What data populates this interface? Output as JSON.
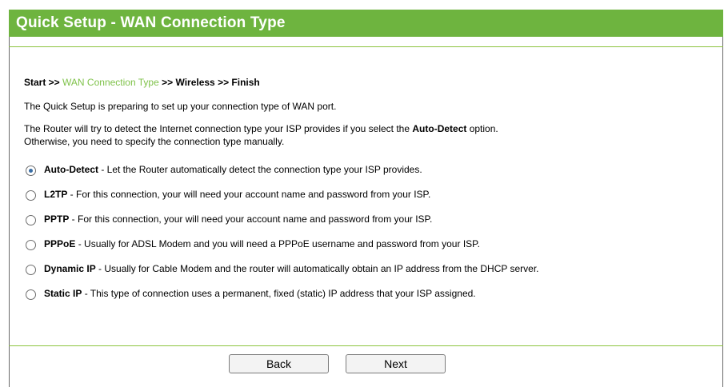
{
  "header": {
    "title": "Quick Setup - WAN Connection Type"
  },
  "breadcrumb": {
    "start": "Start >>",
    "current": "WAN Connection Type",
    "rest": ">> Wireless >> Finish"
  },
  "intro": "The Quick Setup is preparing to set up your connection type of WAN port.",
  "detect": {
    "line1_prefix": "The Router will try to detect the Internet connection type your ISP provides if you select the ",
    "line1_bold": "Auto-Detect",
    "line1_suffix": " option.",
    "line2": "Otherwise, you need to specify the connection type manually."
  },
  "options": [
    {
      "name": "Auto-Detect",
      "desc": " - Let the Router automatically detect the connection type your ISP provides.",
      "selected": true
    },
    {
      "name": "L2TP",
      "desc": " - For this connection, your will need your account name and password from your ISP.",
      "selected": false
    },
    {
      "name": "PPTP",
      "desc": " - For this connection, your will need your account name and password from your ISP.",
      "selected": false
    },
    {
      "name": "PPPoE",
      "desc": " - Usually for ADSL Modem and you will need a PPPoE username and password from your ISP.",
      "selected": false
    },
    {
      "name": "Dynamic IP",
      "desc": " - Usually for Cable Modem and the router will automatically obtain an IP address from the DHCP server.",
      "selected": false
    },
    {
      "name": "Static IP",
      "desc": " - This type of connection uses a permanent, fixed (static) IP address that your ISP assigned.",
      "selected": false
    }
  ],
  "buttons": {
    "back": "Back",
    "next": "Next"
  },
  "colors": {
    "title_bar": "#6eb43f",
    "breadcrumb_current": "#7fc24a"
  }
}
